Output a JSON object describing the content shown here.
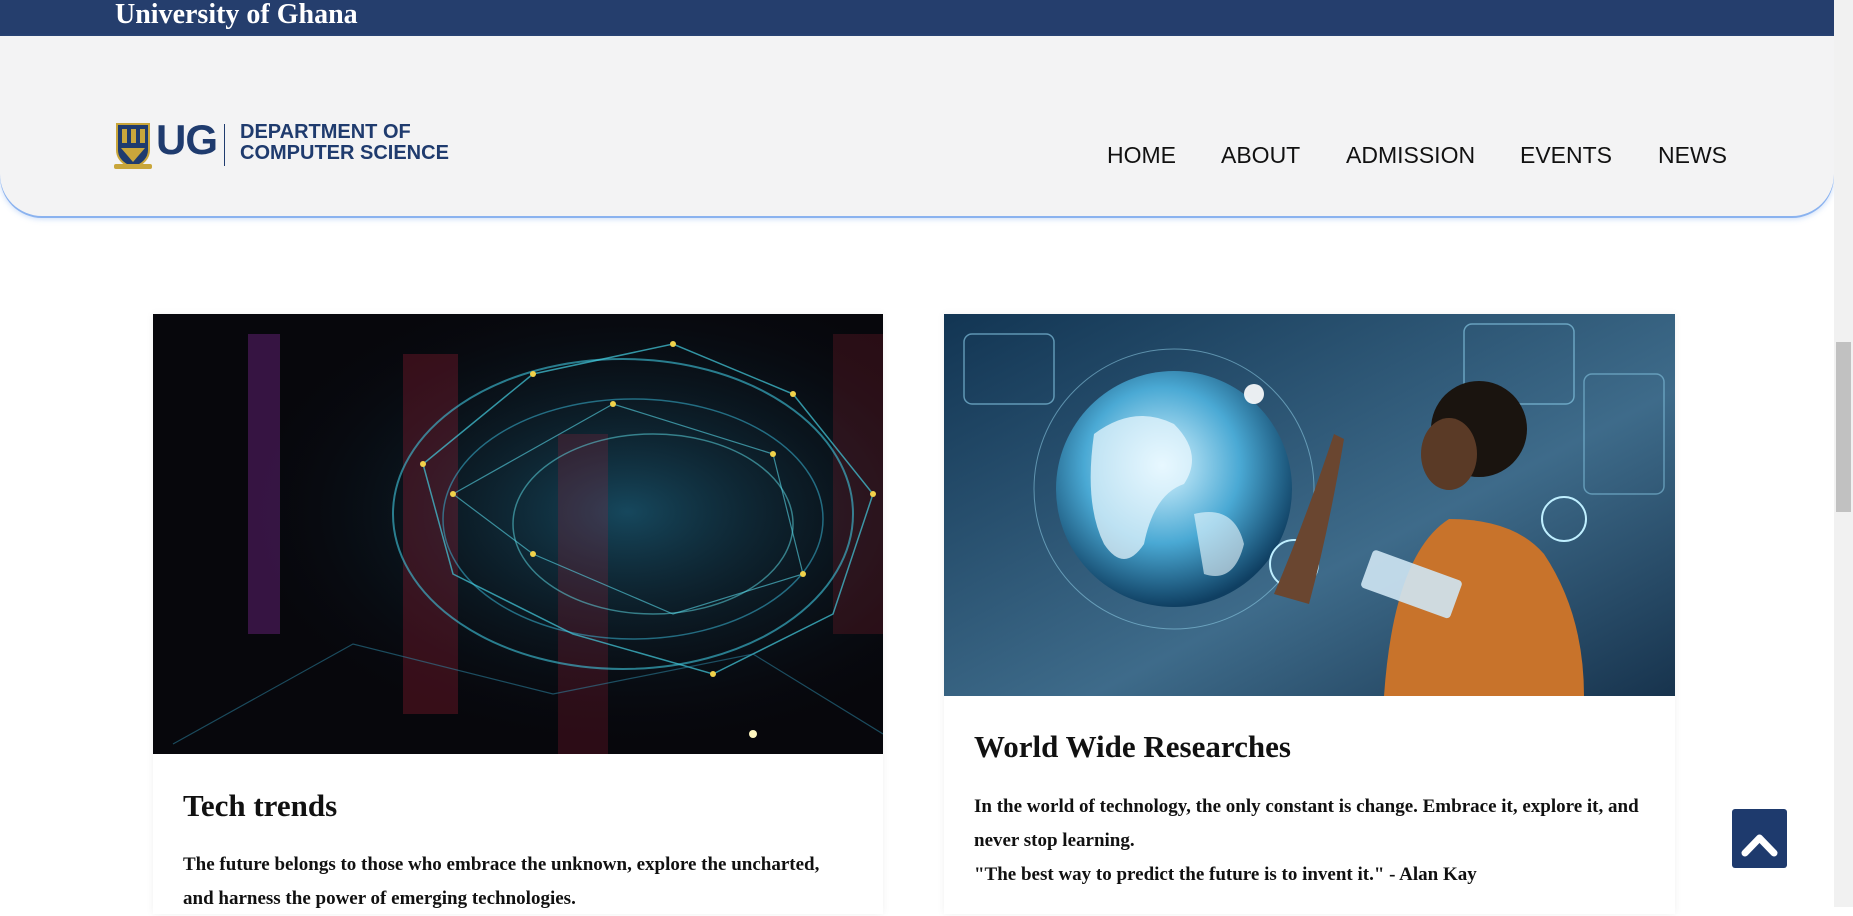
{
  "topbar": {
    "title": "University of Ghana"
  },
  "logo": {
    "short": "UG",
    "dept_line1": "DEPARTMENT OF",
    "dept_line2": "COMPUTER SCIENCE"
  },
  "nav": {
    "items": [
      "HOME",
      "ABOUT",
      "ADMISSION",
      "EVENTS",
      "NEWS"
    ]
  },
  "cards": [
    {
      "image_desc": "network-brain-image",
      "title": "Tech trends",
      "text": "The future belongs to those who embrace the unknown, explore the uncharted, and harness the power of emerging technologies."
    },
    {
      "image_desc": "globe-hologram-image",
      "title": "World Wide Researches",
      "text_line1": "In the world of technology, the only constant is change. Embrace it, explore it, and never stop learning.",
      "text_line2": "\"The best way to predict the future is to invent it.\" - Alan Kay"
    }
  ],
  "colors": {
    "topbar": "#253e6d",
    "brand_blue": "#1f3b6e",
    "header_bg": "#f3f3f4",
    "accent_line": "#8ab2ef",
    "back_to_top": "#1e3a6d"
  },
  "icons": {
    "back_to_top": "chevron-up-icon"
  }
}
